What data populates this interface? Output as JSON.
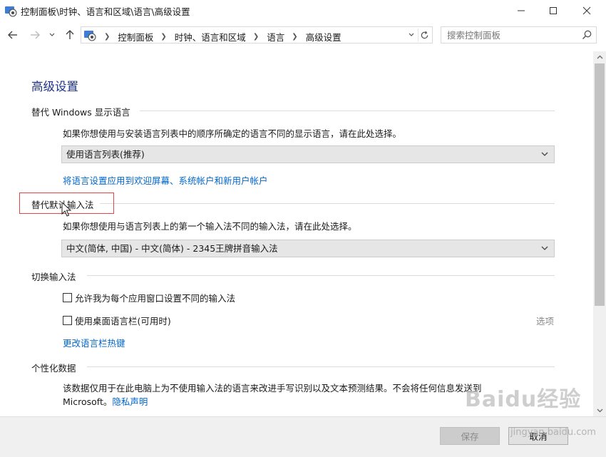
{
  "window": {
    "title": "控制面板\\时钟、语言和区域\\语言\\高级设置"
  },
  "nav": {
    "breadcrumbs": [
      "控制面板",
      "时钟、语言和区域",
      "语言",
      "高级设置"
    ],
    "search_placeholder": "搜索控制面板"
  },
  "page": {
    "title": "高级设置"
  },
  "display_language": {
    "heading": "替代 Windows 显示语言",
    "description": "如果你想使用与安装语言列表中的顺序所确定的语言不同的显示语言，请在此处选择。",
    "selected": "使用语言列表(推荐)",
    "apply_link": "将语言设置应用到欢迎屏幕、系统帐户和新用户帐户"
  },
  "default_input": {
    "heading": "替代默认输入法",
    "description": "如果你想使用与语言列表上的第一个输入法不同的输入法，请在此处选择。",
    "selected": "中文(简体, 中国) - 中文(简体) - 2345王牌拼音输入法"
  },
  "switch_input": {
    "heading": "切换输入法",
    "option_per_app": "允许我为每个应用窗口设置不同的输入法",
    "option_per_app_checked": false,
    "option_language_bar": "使用桌面语言栏(可用时)",
    "option_language_bar_checked": false,
    "options_link": "选项",
    "hotkeys_link": "更改语言栏热键"
  },
  "personalization": {
    "heading": "个性化数据",
    "description_line1": "该数据仅用于在此电脑上为不使用输入法的语言来改进手写识别以及文本预测结果。不会将任何信息发送到",
    "description_line2_prefix": "Microsoft。",
    "privacy_link": "隐私声明"
  },
  "footer": {
    "save_label": "保存",
    "cancel_label": "取消"
  },
  "watermark": {
    "brand": "Baidu经验",
    "sub": "jingyan.baidu.com"
  },
  "colors": {
    "accent_title": "#1e3287",
    "link": "#0066cc",
    "highlight_box": "#e04848"
  }
}
